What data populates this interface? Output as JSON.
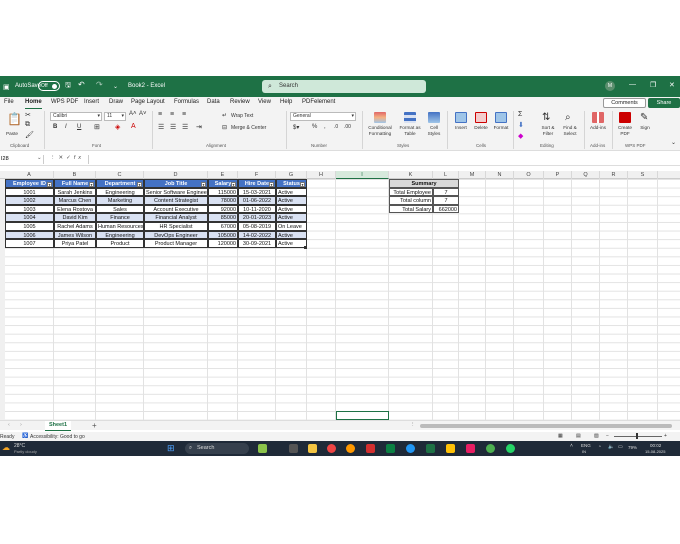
{
  "window": {
    "autosave_label": "AutoSave",
    "autosave_state": "Off",
    "title": "Book2 - Excel",
    "search_placeholder": "Search",
    "user_initials": "M"
  },
  "tabs": [
    "File",
    "Home",
    "WPS PDF",
    "Insert",
    "Draw",
    "Page Layout",
    "Formulas",
    "Data",
    "Review",
    "View",
    "Help",
    "PDFelement"
  ],
  "active_tab": "Home",
  "comments_label": "Comments",
  "share_label": "Share",
  "ribbon": {
    "paste_label": "Paste",
    "font_name": "Calibri",
    "font_size": "11",
    "wrap_text": "Wrap Text",
    "merge_center": "Merge & Center",
    "number_format": "General",
    "conditional_formatting": "Conditional Formatting",
    "format_as_table": "Format as Table",
    "cell_styles": "Cell Styles",
    "insert": "Insert",
    "delete": "Delete",
    "format": "Format",
    "sort_filter": "Sort & Filter",
    "find_select": "Find & Select",
    "addins": "Add-ins",
    "create_pdf": "Create PDF",
    "sign": "Sign",
    "groups": {
      "clipboard": "Clipboard",
      "font": "Font",
      "alignment": "Alignment",
      "number": "Number",
      "styles": "Styles",
      "cells": "Cells",
      "editing": "Editing",
      "addins": "Add-ins",
      "wps_pdf": "WPS PDF"
    }
  },
  "formula_bar": {
    "name_box": "I28",
    "fx": "fx"
  },
  "columns": [
    "A",
    "B",
    "C",
    "D",
    "E",
    "F",
    "G",
    "H",
    "I",
    "J",
    "K",
    "L",
    "M",
    "N",
    "O",
    "P",
    "Q",
    "R",
    "S"
  ],
  "selected_column": "I",
  "table": {
    "headers": [
      "Employee ID",
      "Full Name",
      "Department",
      "Job Title",
      "Salary",
      "Hire Date",
      "Status"
    ],
    "rows": [
      [
        "1001",
        "Sarah Jenkins",
        "Engineering",
        "Senior Software Engineer",
        "115000",
        "15-03-2021",
        "Active"
      ],
      [
        "1002",
        "Marcus Chen",
        "Marketing",
        "Content Strategist",
        "78000",
        "01-06-2022",
        "Active"
      ],
      [
        "1003",
        "Elena Rostova",
        "Sales",
        "Account Executive",
        "92000",
        "10-11-2020",
        "Active"
      ],
      [
        "1004",
        "David Kim",
        "Finance",
        "Financial Analyst",
        "85000",
        "20-01-2023",
        "Active"
      ],
      [
        "1005",
        "Rachel Adams",
        "Human Resources",
        "HR Specialist",
        "67000",
        "05-08-2019",
        "On Leave"
      ],
      [
        "1006",
        "James Wilson",
        "Engineering",
        "DevOps Engineer",
        "105000",
        "14-02-2022",
        "Active"
      ],
      [
        "1007",
        "Priya Patel",
        "Product",
        "Product Manager",
        "120000",
        "30-09-2021",
        "Active"
      ]
    ]
  },
  "summary": {
    "title": "Summary",
    "rows": [
      [
        "Total Employee",
        "7"
      ],
      [
        "Total column",
        "7"
      ],
      [
        "Total Salary",
        "662000"
      ]
    ]
  },
  "sheet_tab": "Sheet1",
  "status": {
    "ready": "Ready",
    "accessibility": "Accessibility: Good to go"
  },
  "taskbar": {
    "weather_temp": "28°C",
    "weather_desc": "Partly cloudy",
    "search_label": "Search",
    "lang": "ENG",
    "lang_sub": "IN",
    "battery": "79%",
    "time": "00:02",
    "date": "15-08-2025"
  }
}
